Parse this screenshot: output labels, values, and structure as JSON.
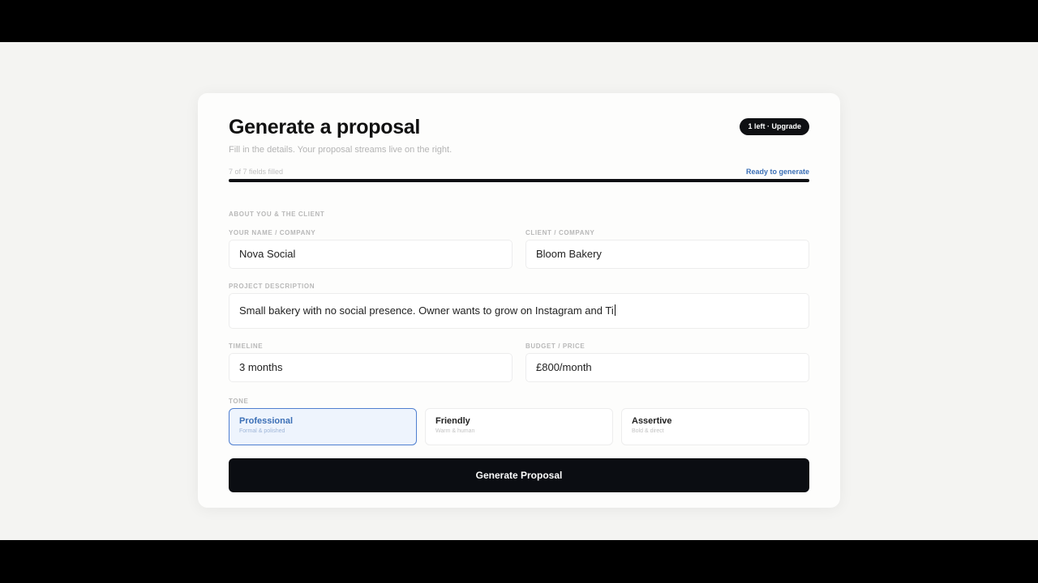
{
  "form": {
    "title": "Generate a proposal",
    "subtitle": "Fill in the details. Your proposal streams live on the right.",
    "badge": "1 left · Upgrade",
    "progress": {
      "count_text": "7 of 7 fields filled",
      "status": "Ready to generate",
      "fraction": 1.0
    },
    "section_label": "ABOUT YOU & THE CLIENT",
    "fields": {
      "your_name": {
        "label": "YOUR NAME / COMPANY",
        "value": "Nova Social"
      },
      "client": {
        "label": "CLIENT / COMPANY",
        "value": "Bloom Bakery"
      },
      "description": {
        "label": "PROJECT DESCRIPTION",
        "value": "Small bakery with no social presence. Owner wants to grow on Instagram and Ti"
      },
      "timeline": {
        "label": "TIMELINE",
        "value": "3 months"
      },
      "budget": {
        "label": "BUDGET / PRICE",
        "value": "£800/month"
      }
    },
    "tone": {
      "label": "TONE",
      "options": [
        {
          "name": "Professional",
          "desc": "Formal & polished",
          "selected": true
        },
        {
          "name": "Friendly",
          "desc": "Warm & human",
          "selected": false
        },
        {
          "name": "Assertive",
          "desc": "Bold & direct",
          "selected": false
        }
      ]
    },
    "generate_label": "Generate Proposal"
  },
  "colors": {
    "accent": "#3b6fb6",
    "button": "#0b0d12",
    "selected_bg": "#eef4fd"
  }
}
